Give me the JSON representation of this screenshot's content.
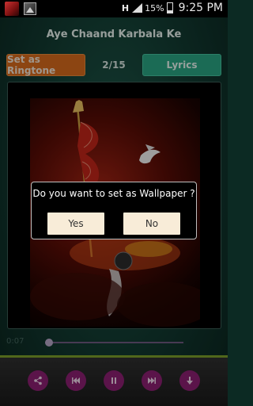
{
  "status_bar": {
    "network_type": "H",
    "battery_percent": "15%",
    "time": "9:25 PM"
  },
  "header": {
    "title": "Aye Chaand Karbala Ke"
  },
  "toolbar": {
    "ringtone_label": "Set as Ringtone",
    "counter": "2/15",
    "lyrics_label": "Lyrics"
  },
  "dialog": {
    "message": "Do you want to set as Wallpaper ?",
    "yes_label": "Yes",
    "no_label": "No"
  },
  "player": {
    "elapsed": "0:07",
    "progress": 0.03
  },
  "controls": {
    "icons": [
      "share-icon",
      "previous-icon",
      "pause-icon",
      "next-icon",
      "download-icon"
    ]
  },
  "colors": {
    "accent_orange": "#d86a1c",
    "accent_teal": "#2aa583",
    "control_magenta": "#8c1f72",
    "divider_green": "#7b9e2a"
  }
}
